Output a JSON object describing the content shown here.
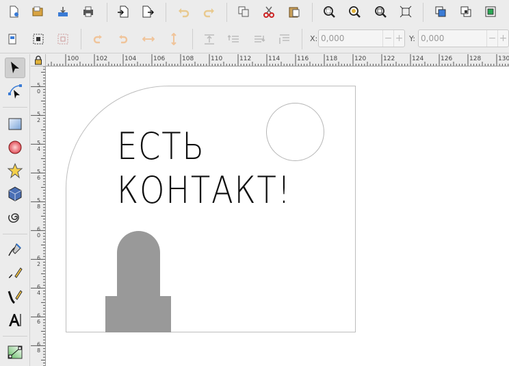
{
  "commands_bar": {
    "buttons": [
      "new-document",
      "open-document",
      "import",
      "print",
      "import-file",
      "export",
      "undo",
      "redo",
      "duplicate",
      "cut",
      "paste",
      "zoom-selection",
      "zoom-drawing",
      "zoom-page",
      "zoom-fit-width",
      "raise",
      "lower",
      "group"
    ]
  },
  "controls_bar": {
    "x_label": "X:",
    "x_value": "0,000",
    "y_label": "Y:",
    "y_value": "0,000",
    "minus": "−",
    "plus": "+"
  },
  "ruler": {
    "horizontal": [
      "100",
      "102",
      "104",
      "106",
      "108",
      "110",
      "112",
      "114",
      "116",
      "118",
      "120",
      "122",
      "124",
      "126",
      "128",
      "130"
    ],
    "vertical": [
      "5\n0",
      "5\n2",
      "5\n4",
      "5\n6",
      "5\n8",
      "6\n0",
      "6\n2",
      "6\n4",
      "6\n6",
      "6\n8"
    ]
  },
  "tools": [
    "selector",
    "node-editor",
    "rectangle",
    "ellipse",
    "star",
    "3d-box",
    "spiral",
    "pencil",
    "pen",
    "calligraphy",
    "text",
    "gradient"
  ],
  "artwork": {
    "line1": "ЕСТЬ",
    "line2": "КОНТАКТ!"
  },
  "colors": {
    "tombstone": "#999999",
    "page_border": "#bdbdbd",
    "accent_red": "#cc2222",
    "accent_blue": "#2a6fc9"
  }
}
